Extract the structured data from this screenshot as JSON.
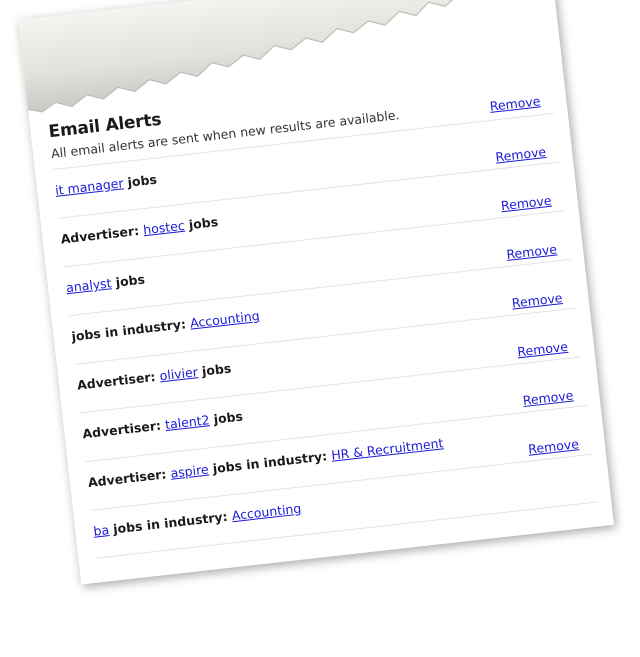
{
  "alerts_panel": {
    "title": "Email Alerts",
    "subtitle": "All email alerts are sent when new results are available.",
    "remove_label": "Remove",
    "items": [
      {
        "parts": [
          {
            "kind": "link",
            "text": "it manager"
          },
          {
            "kind": "bold",
            "text": " jobs"
          }
        ]
      },
      {
        "parts": [
          {
            "kind": "bold",
            "text": "Advertiser: "
          },
          {
            "kind": "link",
            "text": "hostec"
          },
          {
            "kind": "bold",
            "text": " jobs"
          }
        ]
      },
      {
        "parts": [
          {
            "kind": "link",
            "text": "analyst"
          },
          {
            "kind": "bold",
            "text": " jobs"
          }
        ]
      },
      {
        "parts": [
          {
            "kind": "bold",
            "text": "jobs in industry: "
          },
          {
            "kind": "link",
            "text": "Accounting"
          }
        ]
      },
      {
        "parts": [
          {
            "kind": "bold",
            "text": "Advertiser: "
          },
          {
            "kind": "link",
            "text": "olivier"
          },
          {
            "kind": "bold",
            "text": " jobs"
          }
        ]
      },
      {
        "parts": [
          {
            "kind": "bold",
            "text": "Advertiser: "
          },
          {
            "kind": "link",
            "text": "talent2"
          },
          {
            "kind": "bold",
            "text": " jobs"
          }
        ]
      },
      {
        "parts": [
          {
            "kind": "bold",
            "text": "Advertiser: "
          },
          {
            "kind": "link",
            "text": "aspire"
          },
          {
            "kind": "bold",
            "text": " jobs in industry: "
          },
          {
            "kind": "link",
            "text": "HR & Recruitment"
          }
        ]
      },
      {
        "parts": [
          {
            "kind": "link",
            "text": "ba"
          },
          {
            "kind": "bold",
            "text": " jobs in industry: "
          },
          {
            "kind": "link",
            "text": "Accounting"
          }
        ]
      }
    ]
  },
  "colors": {
    "link": "#1a1ad6",
    "text": "#1a1a1a",
    "divider": "#e3e3e3",
    "paper_shadow": "#d8d8d0"
  }
}
